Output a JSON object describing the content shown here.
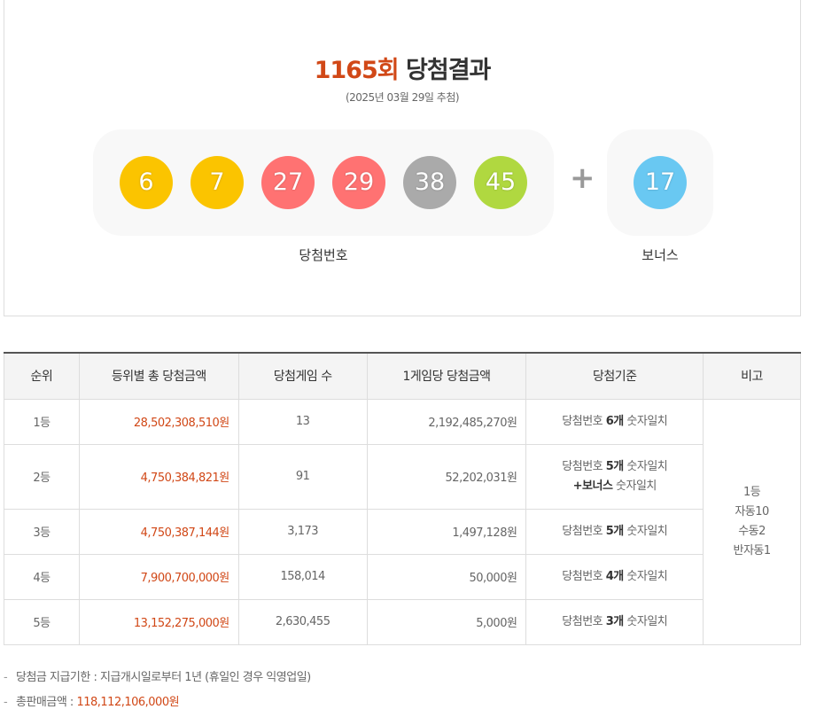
{
  "header": {
    "round": "1165회",
    "title_suffix": "당첨결과",
    "date": "(2025년 03월 29일 추첨)"
  },
  "numbers": {
    "main": [
      {
        "value": "6",
        "color": "#fbc400"
      },
      {
        "value": "7",
        "color": "#fbc400"
      },
      {
        "value": "27",
        "color": "#ff7272"
      },
      {
        "value": "29",
        "color": "#ff7272"
      },
      {
        "value": "38",
        "color": "#aaaaaa"
      },
      {
        "value": "45",
        "color": "#b0d840"
      }
    ],
    "plus": "+",
    "bonus": {
      "value": "17",
      "color": "#69c8f2"
    },
    "main_label": "당첨번호",
    "bonus_label": "보너스"
  },
  "table": {
    "headers": [
      "순위",
      "등위별 총 당첨금액",
      "당첨게임 수",
      "1게임당 당첨금액",
      "당첨기준",
      "비고"
    ],
    "rows": [
      {
        "rank": "1등",
        "total": "28,502,308,510원",
        "games": "13",
        "per_game": "2,192,485,270원",
        "crit_pre": "당첨번호 ",
        "crit_bold": "6개",
        "crit_post": " 숫자일치",
        "crit2_bold": "",
        "crit2_post": ""
      },
      {
        "rank": "2등",
        "total": "4,750,384,821원",
        "games": "91",
        "per_game": "52,202,031원",
        "crit_pre": "당첨번호 ",
        "crit_bold": "5개",
        "crit_post": " 숫자일치",
        "crit2_bold": "+보너스",
        "crit2_post": " 숫자일치"
      },
      {
        "rank": "3등",
        "total": "4,750,387,144원",
        "games": "3,173",
        "per_game": "1,497,128원",
        "crit_pre": "당첨번호 ",
        "crit_bold": "5개",
        "crit_post": " 숫자일치",
        "crit2_bold": "",
        "crit2_post": ""
      },
      {
        "rank": "4등",
        "total": "7,900,700,000원",
        "games": "158,014",
        "per_game": "50,000원",
        "crit_pre": "당첨번호 ",
        "crit_bold": "4개",
        "crit_post": " 숫자일치",
        "crit2_bold": "",
        "crit2_post": ""
      },
      {
        "rank": "5등",
        "total": "13,152,275,000원",
        "games": "2,630,455",
        "per_game": "5,000원",
        "crit_pre": "당첨번호 ",
        "crit_bold": "3개",
        "crit_post": " 숫자일치",
        "crit2_bold": "",
        "crit2_post": ""
      }
    ],
    "note": [
      "1등",
      "자동10",
      "수동2",
      "반자동1"
    ]
  },
  "footer": {
    "dash": "-",
    "deadline_label": "당첨금 지급기한 : ",
    "deadline_value": "지급개시일로부터 1년 (휴일인 경우 익영업일)",
    "sales_label": "총판매금액 : ",
    "sales_value": "118,112,106,000원"
  }
}
